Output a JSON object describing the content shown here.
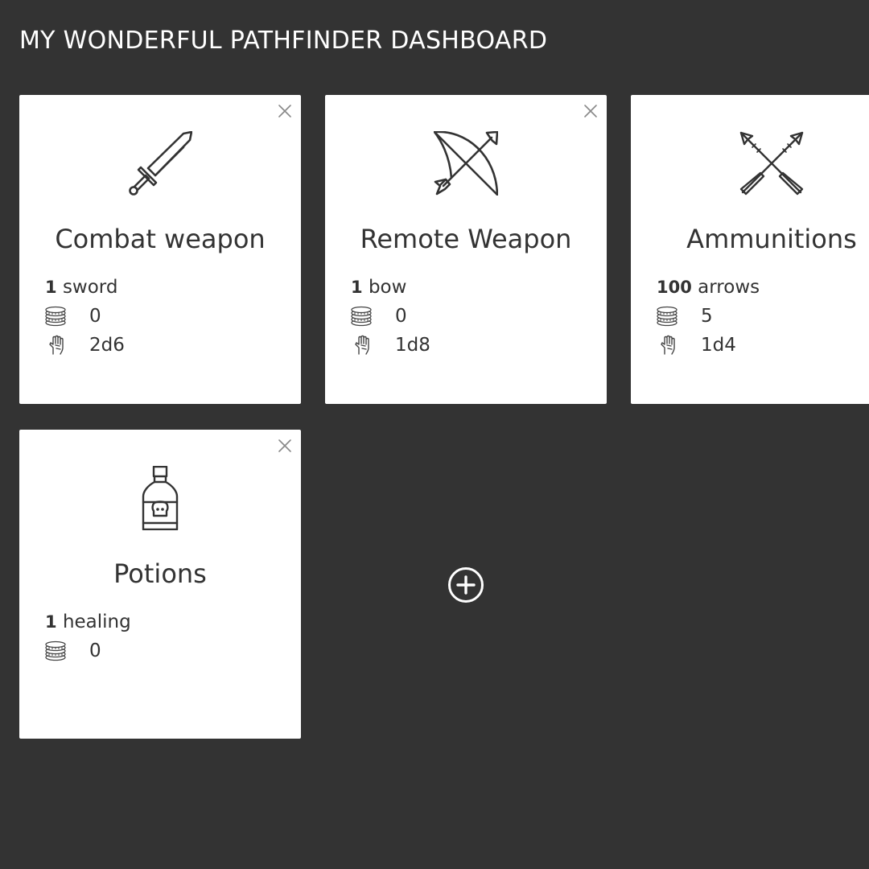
{
  "header": {
    "title": "MY WONDERFUL PATHFINDER DASHBOARD"
  },
  "cards": [
    {
      "title": "Combat weapon",
      "icon": "sword-icon",
      "quantity": "1",
      "item": "sword",
      "cost": "0",
      "damage": "2d6",
      "closable": true
    },
    {
      "title": "Remote Weapon",
      "icon": "bow-and-arrow-icon",
      "quantity": "1",
      "item": "bow",
      "cost": "0",
      "damage": "1d8",
      "closable": true
    },
    {
      "title": "Ammunitions",
      "icon": "crossed-arrows-icon",
      "quantity": "100",
      "item": "arrows",
      "cost": "5",
      "damage": "1d4",
      "closable": false
    },
    {
      "title": "Potions",
      "icon": "poison-bottle-icon",
      "quantity": "1",
      "item": "healing",
      "cost": "0",
      "closable": true
    }
  ],
  "stat_icons": {
    "cost": "coins-icon",
    "damage": "hand-icon"
  },
  "add_button": {
    "icon": "plus-circle-icon"
  },
  "colors": {
    "background": "#333333",
    "card": "#ffffff",
    "text": "#333333",
    "close": "#888888"
  }
}
